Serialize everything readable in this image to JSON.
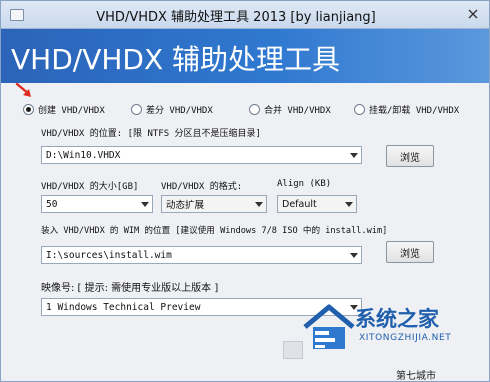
{
  "window": {
    "title": "VHD/VHDX 辅助处理工具 2013 [by lianjiang]",
    "banner_title": "VHD/VHDX 辅助处理工具"
  },
  "modes": [
    {
      "label": "创建 VHD/VHDX",
      "checked": true
    },
    {
      "label": "差分 VHD/VHDX",
      "checked": false
    },
    {
      "label": "合并 VHD/VHDX",
      "checked": false
    },
    {
      "label": "挂载/卸载 VHD/VHDX",
      "checked": false
    }
  ],
  "location": {
    "label": "VHD/VHDX 的位置: [限 NTFS 分区且不是压缩目录]",
    "value": "D:\\Win10.VHDX",
    "browse_label": "浏览"
  },
  "size": {
    "label": "VHD/VHDX 的大小[GB]",
    "value": "50"
  },
  "format": {
    "label": "VHD/VHDX 的格式:",
    "value": "动态扩展"
  },
  "align": {
    "label": "Align (KB)",
    "value": "Default"
  },
  "wim": {
    "label": "装入 VHD/VHDX 的 WIM 的位置 [建议使用 Windows 7/8 ISO 中的 install.wim]",
    "value": "I:\\sources\\install.wim",
    "browse_label": "浏览"
  },
  "image_index": {
    "label": "映像号: [ 提示: 需使用专业版以上版本 ]",
    "value": "1   Windows Technical Preview"
  },
  "watermark": {
    "name": "系统之家",
    "url": "XITONGZHIJIA.NET",
    "site": "第七城市"
  },
  "colors": {
    "banner": "#2f78d0",
    "arrow": "#e02b20",
    "watermark": "#1f5fae"
  }
}
